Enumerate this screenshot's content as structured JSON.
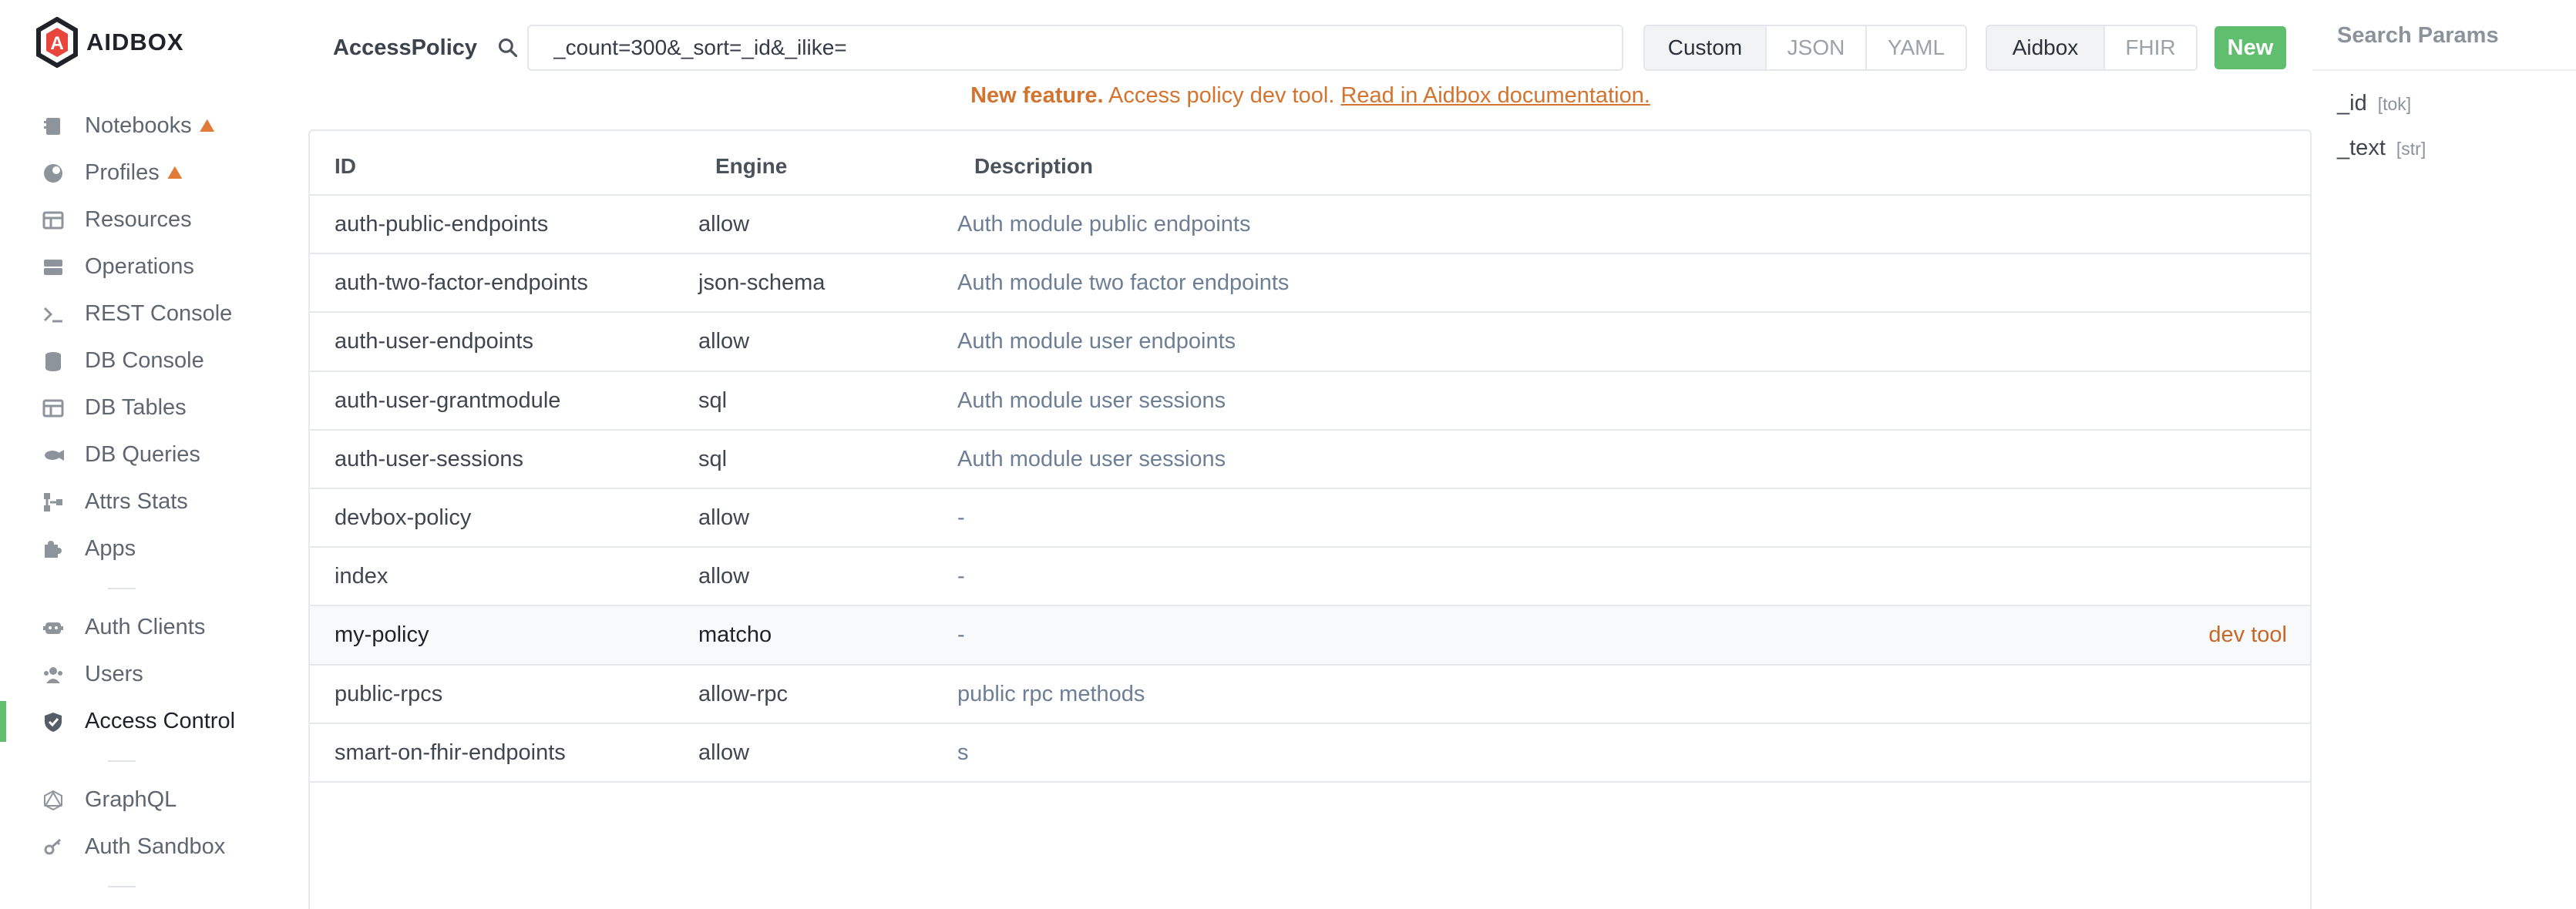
{
  "app": {
    "logo_text": "AIDBOX"
  },
  "sidebar": {
    "items": [
      {
        "label": "Notebooks",
        "icon": "notebook-icon",
        "beta": true
      },
      {
        "label": "Profiles",
        "icon": "profile-icon",
        "beta": true
      },
      {
        "label": "Resources",
        "icon": "table-icon"
      },
      {
        "label": "Operations",
        "icon": "server-icon"
      },
      {
        "label": "REST Console",
        "icon": "terminal-icon"
      },
      {
        "label": "DB Console",
        "icon": "database-icon"
      },
      {
        "label": "DB Tables",
        "icon": "table-icon"
      },
      {
        "label": "DB Queries",
        "icon": "query-icon"
      },
      {
        "label": "Attrs Stats",
        "icon": "graph-icon"
      },
      {
        "label": "Apps",
        "icon": "puzzle-icon"
      },
      {
        "label": "Auth Clients",
        "icon": "robot-icon"
      },
      {
        "label": "Users",
        "icon": "users-icon"
      },
      {
        "label": "Access Control",
        "icon": "shield-icon",
        "active": true
      },
      {
        "label": "GraphQL",
        "icon": "graphql-icon"
      },
      {
        "label": "Auth Sandbox",
        "icon": "key-icon"
      }
    ]
  },
  "toolbar": {
    "resource_title": "AccessPolicy",
    "query_value": "_count=300&_sort=_id&_ilike=",
    "view_modes": [
      "Custom",
      "JSON",
      "YAML"
    ],
    "selected_view_mode": "Custom",
    "formats": [
      "Aidbox",
      "FHIR"
    ],
    "selected_format": "Aidbox",
    "new_label": "New"
  },
  "notice": {
    "strong": "New feature.",
    "text": "Access policy dev tool.",
    "link": "Read in Aidbox documentation."
  },
  "table": {
    "headers": {
      "id": "ID",
      "engine": "Engine",
      "description": "Description"
    },
    "rows": [
      {
        "id": "auth-public-endpoints",
        "engine": "allow",
        "description": "Auth module public endpoints"
      },
      {
        "id": "auth-two-factor-endpoints",
        "engine": "json-schema",
        "description": "Auth module two factor endpoints"
      },
      {
        "id": "auth-user-endpoints",
        "engine": "allow",
        "description": "Auth module user endpoints"
      },
      {
        "id": "auth-user-grantmodule",
        "engine": "sql",
        "description": "Auth module user sessions"
      },
      {
        "id": "auth-user-sessions",
        "engine": "sql",
        "description": "Auth module user sessions"
      },
      {
        "id": "devbox-policy",
        "engine": "allow",
        "description": "-"
      },
      {
        "id": "index",
        "engine": "allow",
        "description": "-"
      },
      {
        "id": "my-policy",
        "engine": "matcho",
        "description": "-",
        "action": "dev tool",
        "highlight": true
      },
      {
        "id": "public-rpcs",
        "engine": "allow-rpc",
        "description": "public rpc methods"
      },
      {
        "id": "smart-on-fhir-endpoints",
        "engine": "allow",
        "description": "s"
      }
    ]
  },
  "search_params": {
    "title": "Search Params",
    "items": [
      {
        "name": "_id",
        "type": "[tok]"
      },
      {
        "name": "_text",
        "type": "[str]"
      }
    ]
  },
  "colors": {
    "accent_green": "#5fbf6e",
    "notice_orange": "#d2742f",
    "description_blue": "#6c7f94"
  }
}
